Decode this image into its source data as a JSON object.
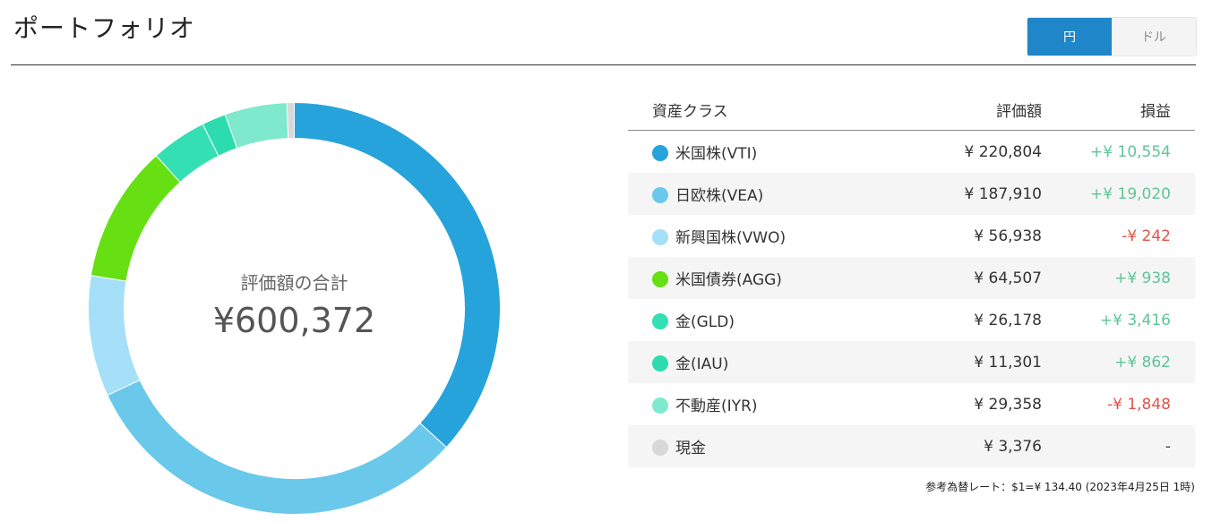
{
  "title": "ポートフォリオ",
  "currency_toggle": {
    "yen_label": "円",
    "dollar_label": "ドル",
    "selected": "円"
  },
  "total": {
    "label": "評価額の合計",
    "value": "¥600,372"
  },
  "table": {
    "headers": {
      "asset": "資産クラス",
      "value": "評価額",
      "pl": "損益"
    },
    "rows": [
      {
        "name": "米国株(VTI)",
        "value": "¥ 220,804",
        "pl": "+¥ 10,554",
        "color": "#27a3db"
      },
      {
        "name": "日欧株(VEA)",
        "value": "¥ 187,910",
        "pl": "+¥ 19,020",
        "color": "#6ac8ea"
      },
      {
        "name": "新興国株(VWO)",
        "value": "¥ 56,938",
        "pl": "-¥ 242",
        "color": "#a5dff8"
      },
      {
        "name": "米国債券(AGG)",
        "value": "¥ 64,507",
        "pl": "+¥ 938",
        "color": "#66e012"
      },
      {
        "name": "金(GLD)",
        "value": "¥ 26,178",
        "pl": "+¥ 3,416",
        "color": "#34dfb3"
      },
      {
        "name": "金(IAU)",
        "value": "¥ 11,301",
        "pl": "+¥ 862",
        "color": "#2cdcae"
      },
      {
        "name": "不動産(IYR)",
        "value": "¥ 29,358",
        "pl": "-¥ 1,848",
        "color": "#7ee9cc"
      },
      {
        "name": "現金",
        "value": "¥ 3,376",
        "pl": "-",
        "color": "#d8d8d8"
      }
    ]
  },
  "chart_data": {
    "type": "pie",
    "donut": true,
    "categories": [
      "米国株(VTI)",
      "日欧株(VEA)",
      "新興国株(VWO)",
      "米国債券(AGG)",
      "金(GLD)",
      "金(IAU)",
      "不動産(IYR)",
      "現金"
    ],
    "values": [
      220804,
      187910,
      56938,
      64507,
      26178,
      11301,
      29358,
      3376
    ],
    "colors": [
      "#27a3db",
      "#6ac8ea",
      "#a5dff8",
      "#66e012",
      "#34dfb3",
      "#2cdcae",
      "#7ee9cc",
      "#d8d8d8"
    ]
  },
  "footnote": "参考為替レート：$1=¥ 134.40 (2023年4月25日 1時)"
}
